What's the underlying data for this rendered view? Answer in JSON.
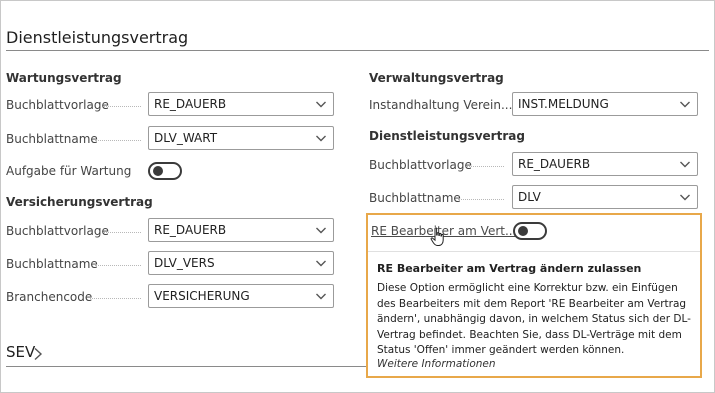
{
  "section": {
    "title": "Dienstleistungsvertrag"
  },
  "left": {
    "wartung": {
      "title": "Wartungsvertrag",
      "fields": [
        {
          "label": "Buchblattvorlage",
          "value": "RE_DAUERB"
        },
        {
          "label": "Buchblattname",
          "value": "DLV_WART"
        }
      ],
      "toggle_label": "Aufgabe für Wartung"
    },
    "versicherung": {
      "title": "Versicherungsvertrag",
      "fields": [
        {
          "label": "Buchblattvorlage",
          "value": "RE_DAUERB"
        },
        {
          "label": "Buchblattname",
          "value": "DLV_VERS"
        },
        {
          "label": "Branchencode",
          "value": "VERSICHERUNG"
        }
      ]
    }
  },
  "right": {
    "verwaltung": {
      "title": "Verwaltungsvertrag",
      "fields": [
        {
          "label": "Instandhaltung Verein...",
          "value": "INST.MELDUNG"
        }
      ]
    },
    "dienstleistung": {
      "title": "Dienstleistungsvertrag",
      "fields": [
        {
          "label": "Buchblattvorlage",
          "value": "RE_DAUERB"
        },
        {
          "label": "Buchblattname",
          "value": "DLV"
        }
      ],
      "toggle_label": "RE Bearbeiter am Vert..."
    }
  },
  "tooltip": {
    "title": "RE Bearbeiter am Vertrag ändern zulassen",
    "body": "Diese Option ermöglicht eine Korrektur bzw. ein Einfügen des Bearbeiters mit dem Report 'RE Bearbeiter am Vertrag ändern', unabhängig davon, in welchem Status sich der DL-Vertrag befindet. Beachten Sie, dass DL-Verträge mit dem Status 'Offen' immer geändert werden können.",
    "more_link": "Weitere Informationen"
  },
  "sev": {
    "title": "SEV"
  },
  "colors": {
    "highlight_border": "#e8a84a",
    "toggle": "#3b3b3b"
  },
  "icons": [
    "chevron-down-icon",
    "chevron-right-icon",
    "hand-cursor-icon"
  ]
}
